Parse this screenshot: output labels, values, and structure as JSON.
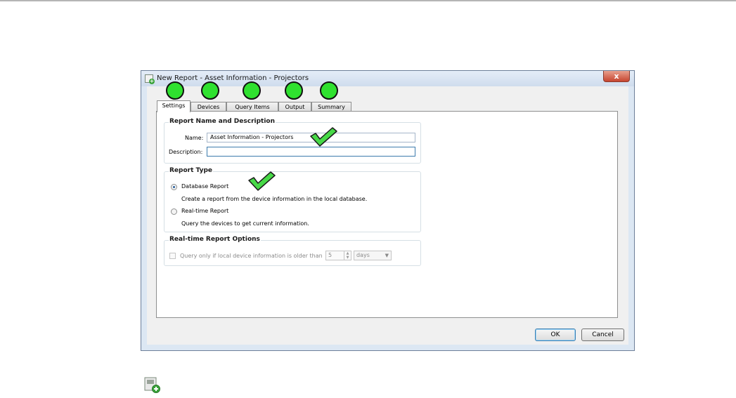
{
  "window": {
    "title": "New Report -  Asset Information - Projectors",
    "close_label": "x"
  },
  "tabs": [
    {
      "label": "Settings",
      "active": true
    },
    {
      "label": "Devices",
      "active": false
    },
    {
      "label": "Query Items",
      "active": false
    },
    {
      "label": "Output",
      "active": false
    },
    {
      "label": "Summary",
      "active": false
    }
  ],
  "report_name_group": {
    "title": "Report Name and Description",
    "name_label": "Name:",
    "name_value": "Asset Information - Projectors",
    "description_label": "Description:",
    "description_value": ""
  },
  "report_type_group": {
    "title": "Report Type",
    "database_label": "Database Report",
    "database_desc": "Create a report from the device information in the local database.",
    "database_selected": true,
    "realtime_label": "Real-time Report",
    "realtime_desc": "Query the devices to get current information.",
    "realtime_selected": false
  },
  "realtime_options_group": {
    "title": "Real-time Report Options",
    "query_label": "Query only if local device information is older than",
    "query_checked": false,
    "interval_value": "5",
    "unit_value": "days"
  },
  "buttons": {
    "ok": "OK",
    "cancel": "Cancel"
  },
  "colors": {
    "annotation_circle": "#2fe12f",
    "check_mark": "#47d947",
    "accent": "#3c7fb1"
  }
}
